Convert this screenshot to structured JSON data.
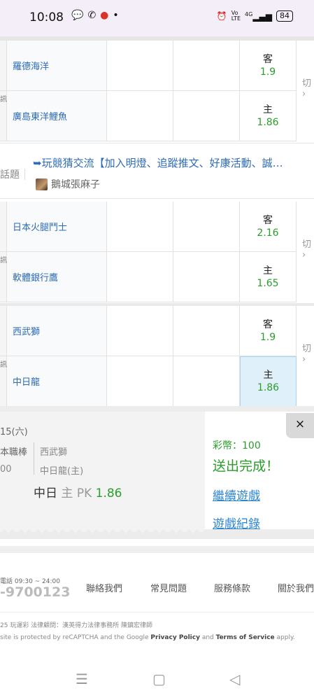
{
  "status_bar": {
    "time": "10:08",
    "left_icons": [
      "message-icon",
      "missed-call-icon",
      "app-notification-icon",
      "dot-icon"
    ],
    "right_icons": [
      "alarm-icon",
      "volte-icon",
      "signal-icon"
    ],
    "network": "4G",
    "battery": "84"
  },
  "games": [
    {
      "side_label": "訊",
      "switch_label": "切",
      "rows": [
        {
          "team": "羅德海洋",
          "odds_type": "客",
          "odds": "1.9",
          "selected": false
        },
        {
          "team": "廣島東洋鯉魚",
          "odds_type": "主",
          "odds": "1.86",
          "selected": false
        }
      ]
    },
    {
      "side_label": "訊",
      "switch_label": "切",
      "rows": [
        {
          "team": "日本火腿鬥士",
          "odds_type": "客",
          "odds": "2.16",
          "selected": false
        },
        {
          "team": "軟體銀行鷹",
          "odds_type": "主",
          "odds": "1.65",
          "selected": false
        }
      ]
    },
    {
      "side_label": "訊",
      "switch_label": "切",
      "rows": [
        {
          "team": "西武獅",
          "odds_type": "客",
          "odds": "1.9",
          "selected": false
        },
        {
          "team": "中日龍",
          "odds_type": "主",
          "odds": "1.86",
          "selected": true
        }
      ]
    }
  ],
  "topic": {
    "label": "話題",
    "title": "➥玩競猜交流【加入明燈、追蹤推文、好康活動、誠…",
    "author": "鵝城張麻子"
  },
  "ticket": {
    "date": "15(六)",
    "league": "本職棒",
    "code": "00",
    "team1": "西武獅",
    "team2": "中日龍(主)",
    "pick_team": "中日",
    "pick_side": "主",
    "pick_type": "PK",
    "pick_odds": "1.86"
  },
  "result": {
    "coins": "彩幣：100",
    "status": "送出完成！",
    "continue_link": "繼續遊戲",
    "history_link": "遊戲紀錄",
    "close": "×"
  },
  "footer": {
    "hours": "電話 09:30 ~ 24:00",
    "phone": "-9700123",
    "links": [
      "聯絡我們",
      "常見問題",
      "服務條款",
      "關於我們"
    ],
    "copyright": "25 玩運彩  法律顧問：漢英得力法律事務所 陳鎮宏律師",
    "recaptcha_prefix": "site is protected by reCAPTCHA and the Google ",
    "privacy": "Privacy Policy",
    "and": " and ",
    "terms": "Terms of Service",
    "apply": " apply."
  },
  "navbar": {
    "icons": [
      "menu-icon",
      "home-icon",
      "back-icon"
    ]
  }
}
